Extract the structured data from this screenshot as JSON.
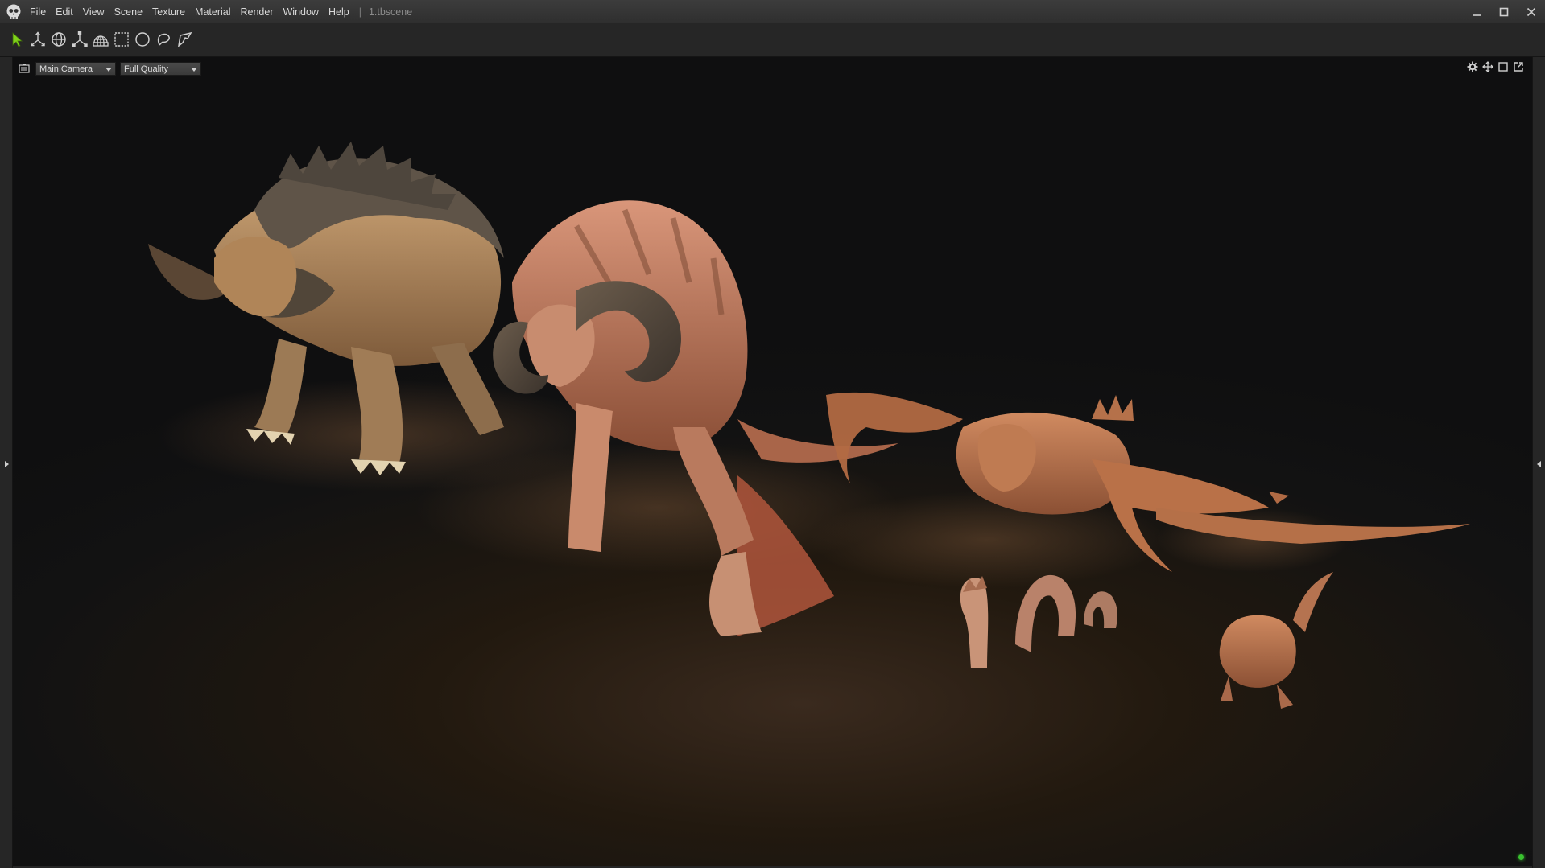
{
  "app": {
    "document_title": "1.tbscene",
    "title_separator": "|",
    "menu": [
      "File",
      "Edit",
      "View",
      "Scene",
      "Texture",
      "Material",
      "Render",
      "Window",
      "Help"
    ]
  },
  "window_controls": [
    "minimize-icon",
    "maximize-icon",
    "close-icon"
  ],
  "toolbar": {
    "tools": [
      {
        "name": "select-tool",
        "icon": "arrow-cursor-icon",
        "active": true
      },
      {
        "name": "move-tool",
        "icon": "move-axes-icon",
        "active": false
      },
      {
        "name": "rotate-tool",
        "icon": "rotate-sphere-icon",
        "active": false
      },
      {
        "name": "scale-tool",
        "icon": "scale-axes-icon",
        "active": false
      },
      {
        "name": "object-tool",
        "icon": "globe-mesh-icon",
        "active": false
      },
      {
        "name": "rect-select-tool",
        "icon": "rectangle-marquee-icon",
        "active": false
      },
      {
        "name": "ellipse-select-tool",
        "icon": "ellipse-marquee-icon",
        "active": false
      },
      {
        "name": "lasso-tool",
        "icon": "lasso-icon",
        "active": false
      },
      {
        "name": "polygon-lasso-tool",
        "icon": "polygon-lasso-icon",
        "active": false
      }
    ]
  },
  "viewport": {
    "camera": "Main Camera",
    "quality": "Full Quality",
    "right_icons": [
      "gear-icon",
      "move-view-icon",
      "frame-icon",
      "popout-icon"
    ],
    "status_color": "#39c22f"
  },
  "colors": {
    "accent_green": "#7fd21a",
    "icon_gray": "#cfcfcf"
  }
}
